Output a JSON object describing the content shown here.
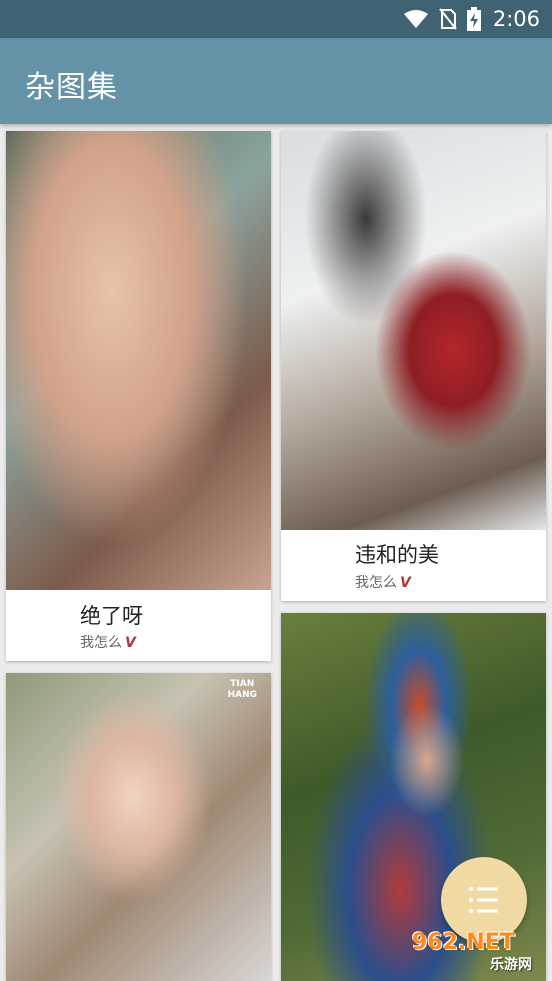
{
  "status_bar": {
    "time": "2:06",
    "icons": [
      "wifi-icon",
      "no-sim-icon",
      "battery-charging-icon"
    ]
  },
  "app_bar": {
    "title": "杂图集"
  },
  "feed": {
    "cards": [
      {
        "title": "绝了呀",
        "author": "我怎么",
        "verified_mark": "V"
      },
      {
        "title": "违和的美",
        "author": "我怎么",
        "verified_mark": "V"
      },
      {
        "title": "",
        "author": "",
        "verified_mark": "",
        "watermark": "TIAN\nHANG"
      },
      {
        "title": "",
        "author": "",
        "verified_mark": ""
      }
    ]
  },
  "fab": {
    "icon": "list-icon"
  },
  "site_logo": {
    "main": "962.NET",
    "sub": "乐游网"
  },
  "colors": {
    "status_bar": "#3f6373",
    "app_bar": "#6493a7",
    "background": "#ebebeb",
    "fab": "#f0d9a2",
    "verified_mark": "#b0353e"
  }
}
